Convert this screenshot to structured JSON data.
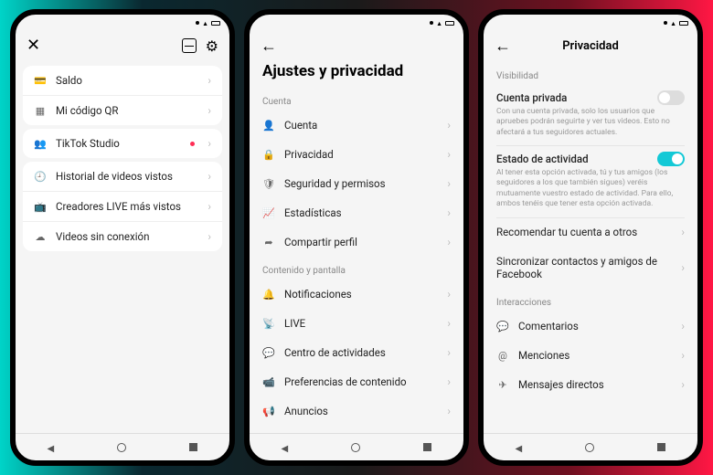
{
  "phone1": {
    "card1": [
      {
        "icon": "💳",
        "label": "Saldo",
        "dot": false
      },
      {
        "icon": "▦",
        "label": "Mi código QR",
        "dot": false
      }
    ],
    "card2": [
      {
        "icon": "👥",
        "label": "TikTok Studio",
        "dot": true
      }
    ],
    "card3": [
      {
        "icon": "🕘",
        "label": "Historial de videos vistos",
        "dot": false
      },
      {
        "icon": "📺",
        "label": "Creadores LIVE más vistos",
        "dot": false
      },
      {
        "icon": "☁",
        "label": "Videos sin conexión",
        "dot": false
      }
    ]
  },
  "phone2": {
    "title": "Ajustes y privacidad",
    "section1_label": "Cuenta",
    "section1": [
      {
        "icon": "👤",
        "label": "Cuenta"
      },
      {
        "icon": "🔒",
        "label": "Privacidad"
      },
      {
        "icon": "🛡",
        "label": "Seguridad y permisos"
      },
      {
        "icon": "📈",
        "label": "Estadísticas"
      },
      {
        "icon": "➦",
        "label": "Compartir perfil"
      }
    ],
    "section2_label": "Contenido y pantalla",
    "section2": [
      {
        "icon": "🔔",
        "label": "Notificaciones"
      },
      {
        "icon": "📡",
        "label": "LIVE"
      },
      {
        "icon": "💬",
        "label": "Centro de actividades"
      },
      {
        "icon": "📹",
        "label": "Preferencias de contenido"
      },
      {
        "icon": "📢",
        "label": "Anuncios"
      }
    ]
  },
  "phone3": {
    "title": "Privacidad",
    "section1_label": "Visibilidad",
    "private_account": {
      "title": "Cuenta privada",
      "desc": "Con una cuenta privada, solo los usuarios que apruebes podrán seguirte y ver tus videos. Esto no afectará a tus seguidores actuales.",
      "on": false
    },
    "activity_status": {
      "title": "Estado de actividad",
      "desc": "Al tener esta opción activada, tú y tus amigos (los seguidores a los que también sigues) veréis mutuamente vuestro estado de actividad. Para ello, ambos tenéis que tener esta opción activada.",
      "on": true
    },
    "rows1": [
      {
        "label": "Recomendar tu cuenta a otros"
      },
      {
        "label": "Sincronizar contactos y amigos de Facebook"
      }
    ],
    "section2_label": "Interacciones",
    "rows2": [
      {
        "icon": "💬",
        "label": "Comentarios"
      },
      {
        "icon": "@",
        "label": "Menciones"
      },
      {
        "icon": "✈",
        "label": "Mensajes directos"
      }
    ]
  }
}
